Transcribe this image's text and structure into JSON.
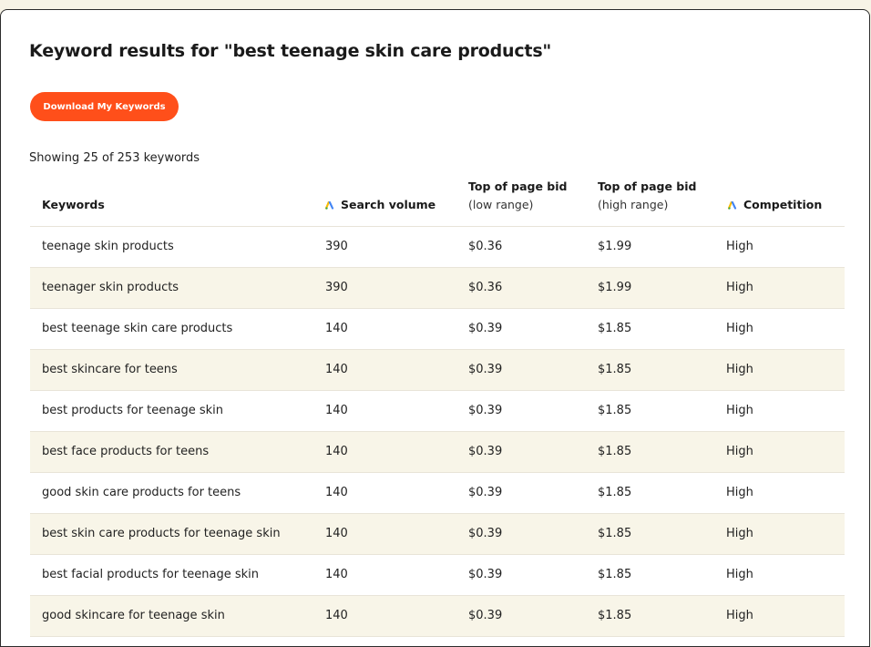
{
  "header": {
    "title": "Keyword results for \"best teenage skin care products\"",
    "download_label": "Download My Keywords",
    "showing_text": "Showing 25 of 253 keywords"
  },
  "table": {
    "columns": {
      "keywords": "Keywords",
      "search_volume": "Search volume",
      "bid_low_title": "Top of page bid",
      "bid_low_sub": "(low range)",
      "bid_high_title": "Top of page bid",
      "bid_high_sub": "(high range)",
      "competition": "Competition"
    },
    "rows": [
      {
        "keyword": "teenage skin products",
        "volume": "390",
        "low": "$0.36",
        "high": "$1.99",
        "competition": "High"
      },
      {
        "keyword": "teenager skin products",
        "volume": "390",
        "low": "$0.36",
        "high": "$1.99",
        "competition": "High"
      },
      {
        "keyword": "best teenage skin care products",
        "volume": "140",
        "low": "$0.39",
        "high": "$1.85",
        "competition": "High"
      },
      {
        "keyword": "best skincare for teens",
        "volume": "140",
        "low": "$0.39",
        "high": "$1.85",
        "competition": "High"
      },
      {
        "keyword": "best products for teenage skin",
        "volume": "140",
        "low": "$0.39",
        "high": "$1.85",
        "competition": "High"
      },
      {
        "keyword": "best face products for teens",
        "volume": "140",
        "low": "$0.39",
        "high": "$1.85",
        "competition": "High"
      },
      {
        "keyword": "good skin care products for teens",
        "volume": "140",
        "low": "$0.39",
        "high": "$1.85",
        "competition": "High"
      },
      {
        "keyword": "best skin care products for teenage skin",
        "volume": "140",
        "low": "$0.39",
        "high": "$1.85",
        "competition": "High"
      },
      {
        "keyword": "best facial products for teenage skin",
        "volume": "140",
        "low": "$0.39",
        "high": "$1.85",
        "competition": "High"
      },
      {
        "keyword": "good skincare for teenage skin",
        "volume": "140",
        "low": "$0.39",
        "high": "$1.85",
        "competition": "High"
      }
    ]
  },
  "icons": {
    "google_ads": "google-ads-icon"
  },
  "colors": {
    "accent": "#ff4f1a",
    "row_alt": "#f8f5e8",
    "ads_blue": "#4285f4",
    "ads_yellow": "#fbbc04",
    "ads_green": "#34a853"
  }
}
